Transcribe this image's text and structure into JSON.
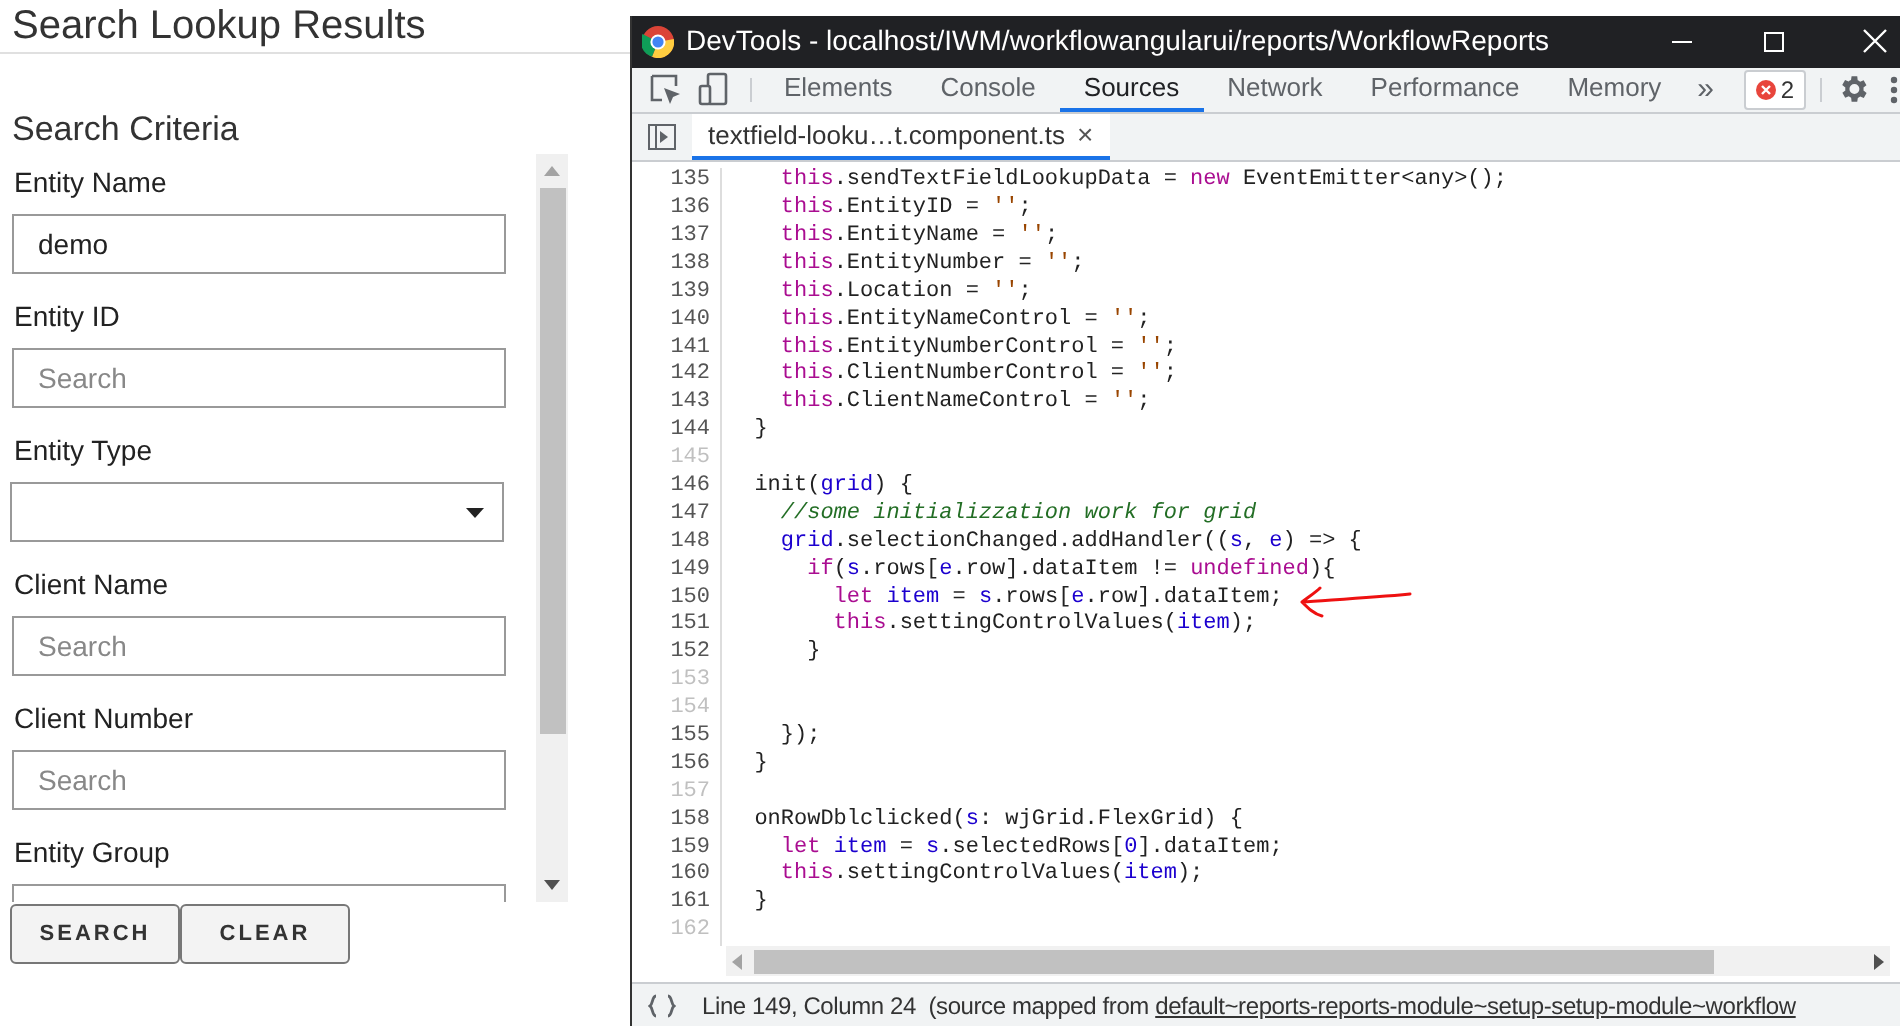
{
  "page": {
    "title": "Search Lookup Results",
    "section_title": "Search Criteria",
    "fields": [
      {
        "label": "Entity Name",
        "kind": "text",
        "value": "demo"
      },
      {
        "label": "Entity ID",
        "kind": "text",
        "placeholder": "Search"
      },
      {
        "label": "Entity Type",
        "kind": "select"
      },
      {
        "label": "Client Name",
        "kind": "text",
        "placeholder": "Search"
      },
      {
        "label": "Client Number",
        "kind": "text",
        "placeholder": "Search"
      },
      {
        "label": "Entity Group",
        "kind": "text"
      }
    ],
    "buttons": [
      "SEARCH",
      "CLEAR"
    ]
  },
  "devtools": {
    "window_title": "DevTools - localhost/IWM/workflowangularui/reports/WorkflowReports",
    "tabs": [
      {
        "label": "Elements",
        "selected": false
      },
      {
        "label": "Console",
        "selected": false
      },
      {
        "label": "Sources",
        "selected": true
      },
      {
        "label": "Network",
        "selected": false
      },
      {
        "label": "Performance",
        "selected": false
      },
      {
        "label": "Memory",
        "selected": false
      }
    ],
    "more_tabs": "»",
    "error_count": "2",
    "file_tab": {
      "label": "textfield-looku…t.component.ts",
      "close": "×"
    },
    "code_lines": [
      {
        "number": "135",
        "tokens": [
          {
            "kind": "keyword",
            "text": "    this"
          },
          {
            "kind": "plain",
            "text": ".sendTextFieldLookupData = "
          },
          {
            "kind": "keyword",
            "text": "new"
          },
          {
            "kind": "plain",
            "text": " EventEmitter<any>();"
          }
        ]
      },
      {
        "number": "136",
        "tokens": [
          {
            "kind": "keyword",
            "text": "    this"
          },
          {
            "kind": "plain",
            "text": ".EntityID = "
          },
          {
            "kind": "string",
            "text": "''"
          },
          {
            "kind": "plain",
            "text": ";"
          }
        ]
      },
      {
        "number": "137",
        "tokens": [
          {
            "kind": "keyword",
            "text": "    this"
          },
          {
            "kind": "plain",
            "text": ".EntityName = "
          },
          {
            "kind": "string",
            "text": "''"
          },
          {
            "kind": "plain",
            "text": ";"
          }
        ]
      },
      {
        "number": "138",
        "tokens": [
          {
            "kind": "keyword",
            "text": "    this"
          },
          {
            "kind": "plain",
            "text": ".EntityNumber = "
          },
          {
            "kind": "string",
            "text": "''"
          },
          {
            "kind": "plain",
            "text": ";"
          }
        ]
      },
      {
        "number": "139",
        "tokens": [
          {
            "kind": "keyword",
            "text": "    this"
          },
          {
            "kind": "plain",
            "text": ".Location = "
          },
          {
            "kind": "string",
            "text": "''"
          },
          {
            "kind": "plain",
            "text": ";"
          }
        ]
      },
      {
        "number": "140",
        "tokens": [
          {
            "kind": "keyword",
            "text": "    this"
          },
          {
            "kind": "plain",
            "text": ".EntityNameControl = "
          },
          {
            "kind": "string",
            "text": "''"
          },
          {
            "kind": "plain",
            "text": ";"
          }
        ]
      },
      {
        "number": "141",
        "tokens": [
          {
            "kind": "keyword",
            "text": "    this"
          },
          {
            "kind": "plain",
            "text": ".EntityNumberControl = "
          },
          {
            "kind": "string",
            "text": "''"
          },
          {
            "kind": "plain",
            "text": ";"
          }
        ]
      },
      {
        "number": "142",
        "tokens": [
          {
            "kind": "keyword",
            "text": "    this"
          },
          {
            "kind": "plain",
            "text": ".ClientNumberControl = "
          },
          {
            "kind": "string",
            "text": "''"
          },
          {
            "kind": "plain",
            "text": ";"
          }
        ]
      },
      {
        "number": "143",
        "tokens": [
          {
            "kind": "keyword",
            "text": "    this"
          },
          {
            "kind": "plain",
            "text": ".ClientNameControl = "
          },
          {
            "kind": "string",
            "text": "''"
          },
          {
            "kind": "plain",
            "text": ";"
          }
        ]
      },
      {
        "number": "144",
        "tokens": [
          {
            "kind": "plain",
            "text": "  }"
          }
        ]
      },
      {
        "number": "145"
      },
      {
        "number": "146",
        "tokens": [
          {
            "kind": "plain",
            "text": "  init("
          },
          {
            "kind": "variable",
            "text": "grid"
          },
          {
            "kind": "plain",
            "text": ") {"
          }
        ]
      },
      {
        "number": "147",
        "tokens": [
          {
            "kind": "comment",
            "text": "    //some initializzation work for grid"
          }
        ]
      },
      {
        "number": "148",
        "tokens": [
          {
            "kind": "variable",
            "text": "    grid"
          },
          {
            "kind": "plain",
            "text": ".selectionChanged.addHandler(("
          },
          {
            "kind": "variable",
            "text": "s"
          },
          {
            "kind": "plain",
            "text": ", "
          },
          {
            "kind": "variable",
            "text": "e"
          },
          {
            "kind": "plain",
            "text": ") => {"
          }
        ]
      },
      {
        "number": "149",
        "tokens": [
          {
            "kind": "keyword",
            "text": "      if"
          },
          {
            "kind": "plain",
            "text": "("
          },
          {
            "kind": "variable",
            "text": "s"
          },
          {
            "kind": "plain",
            "text": ".rows["
          },
          {
            "kind": "variable",
            "text": "e"
          },
          {
            "kind": "plain",
            "text": ".row].dataItem != "
          },
          {
            "kind": "keyword",
            "text": "undefined"
          },
          {
            "kind": "plain",
            "text": "){"
          }
        ]
      },
      {
        "number": "150",
        "tokens": [
          {
            "kind": "keyword",
            "text": "        let"
          },
          {
            "kind": "variable",
            "text": " item"
          },
          {
            "kind": "plain",
            "text": " = "
          },
          {
            "kind": "variable",
            "text": "s"
          },
          {
            "kind": "plain",
            "text": ".rows["
          },
          {
            "kind": "variable",
            "text": "e"
          },
          {
            "kind": "plain",
            "text": ".row].dataItem;"
          }
        ]
      },
      {
        "number": "151",
        "tokens": [
          {
            "kind": "keyword",
            "text": "        this"
          },
          {
            "kind": "plain",
            "text": ".settingControlValues("
          },
          {
            "kind": "variable",
            "text": "item"
          },
          {
            "kind": "plain",
            "text": ");"
          }
        ]
      },
      {
        "number": "152",
        "tokens": [
          {
            "kind": "plain",
            "text": "      }"
          }
        ]
      },
      {
        "number": "153"
      },
      {
        "number": "154"
      },
      {
        "number": "155",
        "tokens": [
          {
            "kind": "plain",
            "text": "    });"
          }
        ]
      },
      {
        "number": "156",
        "tokens": [
          {
            "kind": "plain",
            "text": "  }"
          }
        ]
      },
      {
        "number": "157"
      },
      {
        "number": "158",
        "tokens": [
          {
            "kind": "plain",
            "text": "  onRowDblclicked("
          },
          {
            "kind": "variable",
            "text": "s"
          },
          {
            "kind": "plain",
            "text": ": wjGrid.FlexGrid) {"
          }
        ]
      },
      {
        "number": "159",
        "tokens": [
          {
            "kind": "keyword",
            "text": "    let"
          },
          {
            "kind": "variable",
            "text": " item"
          },
          {
            "kind": "plain",
            "text": " = "
          },
          {
            "kind": "variable",
            "text": "s"
          },
          {
            "kind": "plain",
            "text": ".selectedRows["
          },
          {
            "kind": "number",
            "text": "0"
          },
          {
            "kind": "plain",
            "text": "].dataItem;"
          }
        ]
      },
      {
        "number": "160",
        "tokens": [
          {
            "kind": "keyword",
            "text": "    this"
          },
          {
            "kind": "plain",
            "text": ".settingControlValues("
          },
          {
            "kind": "variable",
            "text": "item"
          },
          {
            "kind": "plain",
            "text": ");"
          }
        ]
      },
      {
        "number": "161",
        "tokens": [
          {
            "kind": "plain",
            "text": "  }"
          }
        ]
      },
      {
        "number": "162"
      }
    ],
    "status": {
      "position": "Line 149, Column 24",
      "source_note": "(source mapped from",
      "source_link": "default~reports-reports-module~setup-setup-module~workflow"
    }
  }
}
